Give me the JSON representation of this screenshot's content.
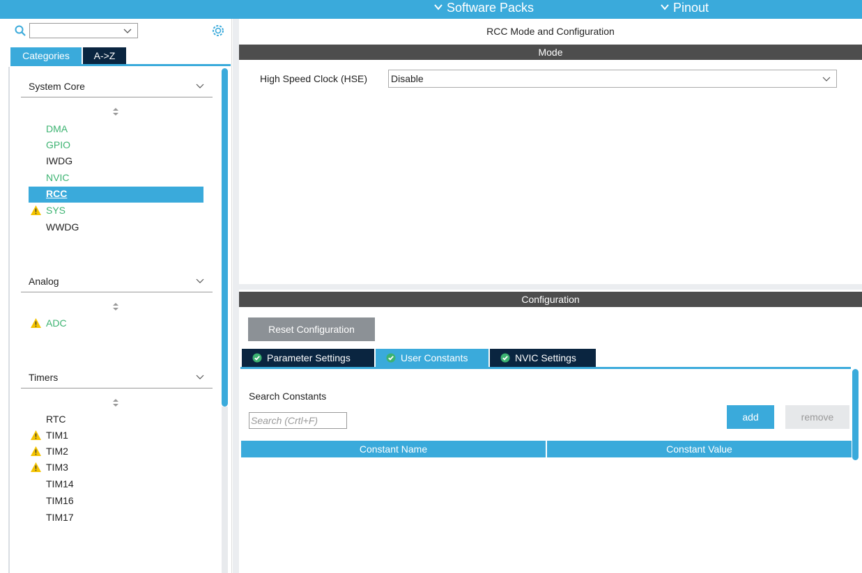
{
  "topbar": {
    "menus": [
      {
        "label": "Software Packs"
      },
      {
        "label": "Pinout"
      }
    ]
  },
  "sidebar": {
    "search_value": "",
    "tabs": [
      {
        "label": "Categories",
        "active": true
      },
      {
        "label": "A->Z",
        "active": false
      }
    ],
    "categories": [
      {
        "label": "System Core",
        "items": [
          {
            "label": "DMA",
            "status": "green",
            "warning": false
          },
          {
            "label": "GPIO",
            "status": "green",
            "warning": false
          },
          {
            "label": "IWDG",
            "status": "default",
            "warning": false
          },
          {
            "label": "NVIC",
            "status": "green",
            "warning": false
          },
          {
            "label": "RCC",
            "status": "selected",
            "warning": false
          },
          {
            "label": "SYS",
            "status": "green",
            "warning": true
          },
          {
            "label": "WWDG",
            "status": "default",
            "warning": false
          }
        ]
      },
      {
        "label": "Analog",
        "items": [
          {
            "label": "ADC",
            "status": "green",
            "warning": true
          }
        ]
      },
      {
        "label": "Timers",
        "items": [
          {
            "label": "RTC",
            "status": "default",
            "warning": false
          },
          {
            "label": "TIM1",
            "status": "default",
            "warning": true
          },
          {
            "label": "TIM2",
            "status": "default",
            "warning": true
          },
          {
            "label": "TIM3",
            "status": "default",
            "warning": true
          },
          {
            "label": "TIM14",
            "status": "default",
            "warning": false
          },
          {
            "label": "TIM16",
            "status": "default",
            "warning": false
          },
          {
            "label": "TIM17",
            "status": "default",
            "warning": false
          }
        ]
      }
    ]
  },
  "main": {
    "title": "RCC Mode and Configuration",
    "mode_header": "Mode",
    "hse_label": "High Speed Clock (HSE)",
    "hse_value": "Disable",
    "config_header": "Configuration",
    "reset_label": "Reset Configuration",
    "config_tabs": [
      {
        "label": "Parameter Settings",
        "active": false
      },
      {
        "label": "User Constants",
        "active": true
      },
      {
        "label": "NVIC Settings",
        "active": false
      }
    ],
    "search_constants_label": "Search Constants",
    "search_constants_placeholder": "Search (Crtl+F)",
    "add_label": "add",
    "remove_label": "remove",
    "table_headers": [
      "Constant Name",
      "Constant Value"
    ]
  },
  "colors": {
    "accent": "#3aaadb",
    "dark_tab": "#0a2540",
    "section_bar": "#4d4d4d",
    "ok_green": "#3cb371",
    "warning": "#f5c400"
  },
  "icons": {
    "search": "search-icon",
    "settings": "gear-icon",
    "chevron": "chevron-down-icon",
    "warning": "warning-icon",
    "check": "check-circle-icon",
    "sort": "sort-icon"
  }
}
